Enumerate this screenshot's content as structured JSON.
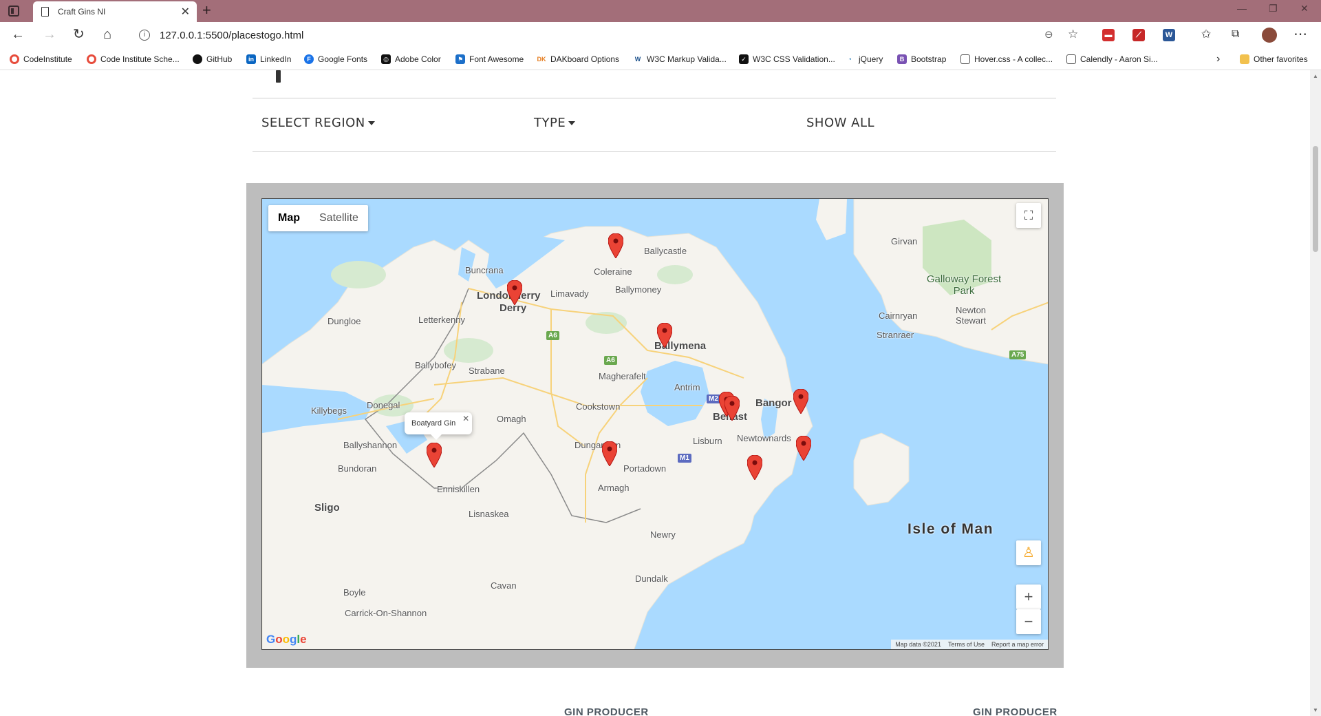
{
  "browser": {
    "tab_title": "Craft Gins NI",
    "url": "127.0.0.1:5500/placestogo.html",
    "bookmarks": [
      "CodeInstitute",
      "Code Institute Sche...",
      "GitHub",
      "LinkedIn",
      "Google Fonts",
      "Adobe Color",
      "Font Awesome",
      "DAKboard Options",
      "W3C Markup Valida...",
      "W3C CSS Validation...",
      "jQuery",
      "Bootstrap",
      "Hover.css - A collec...",
      "Calendly - Aaron Si..."
    ],
    "other_favorites": "Other favorites"
  },
  "filters": {
    "region": "SELECT REGION",
    "type": "TYPE",
    "show_all": "SHOW ALL"
  },
  "map": {
    "map_label": "Map",
    "satellite_label": "Satellite",
    "popup_text": "Boatyard Gin",
    "attribution": {
      "data": "Map data ©2021",
      "terms": "Terms of Use",
      "report": "Report a map error"
    },
    "google": "Google",
    "places": {
      "ballycastle": "Ballycastle",
      "coleraine": "Coleraine",
      "buncrana": "Buncrana",
      "londonderry": "Londonderry",
      "derry": "Derry",
      "limavady": "Limavady",
      "ballymoney": "Ballymoney",
      "dungloe": "Dungloe",
      "letterkenny": "Letterkenny",
      "ballymena": "Ballymena",
      "ballybofey": "Ballybofey",
      "strabane": "Strabane",
      "magherafelt": "Magherafelt",
      "antrim": "Antrim",
      "donegal": "Donegal",
      "killybegs": "Killybegs",
      "omagh": "Omagh",
      "cookstown": "Cookstown",
      "belfast": "Belfast",
      "bangor": "Bangor",
      "ballyshannon": "Ballyshannon",
      "bundoran": "Bundoran",
      "dungannon": "Dungannon",
      "lisburn": "Lisburn",
      "newtownards": "Newtownards",
      "portadown": "Portadown",
      "enniskillen": "Enniskillen",
      "armagh": "Armagh",
      "sligo": "Sligo",
      "lisnaskea": "Lisnaskea",
      "newry": "Newry",
      "dundalk": "Dundalk",
      "cavan": "Cavan",
      "boyle": "Boyle",
      "carrick": "Carrick-On-Shannon",
      "girvan": "Girvan",
      "galloway": "Galloway Forest Park",
      "cairnryan": "Cairnryan",
      "newton_stewart": "Newton Stewart",
      "stranraer": "Stranraer",
      "isle_of_man": "Isle of Man"
    },
    "roads": {
      "a6a": "A6",
      "a6b": "A6",
      "m2": "M2",
      "m1": "M1",
      "a75": "A75"
    }
  },
  "sections": {
    "left_heading": "GIN PRODUCER",
    "right_heading": "GIN PRODUCER"
  }
}
